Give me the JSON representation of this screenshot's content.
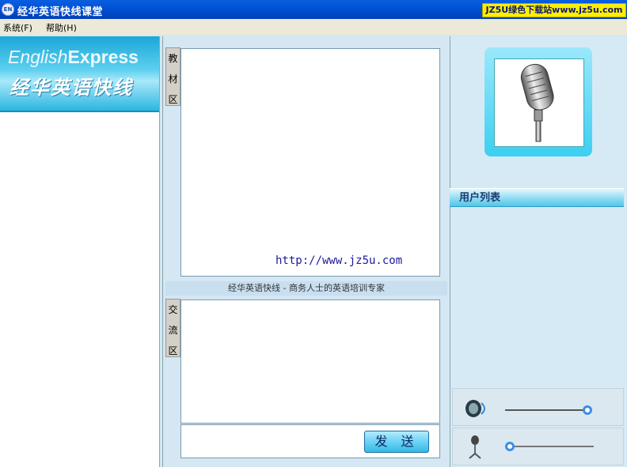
{
  "window": {
    "icon_text": "EN",
    "title": "经华英语快线课堂",
    "promo": "JZ5U绿色下载站www.jz5u.com"
  },
  "menu": [
    {
      "label": "系统(F)"
    },
    {
      "label": "帮助(H)"
    }
  ],
  "logo": {
    "english_light": "English",
    "english_bold": "Express",
    "chinese": "经华英语快线"
  },
  "textbook": {
    "tab_chars": [
      "教",
      "材",
      "区"
    ],
    "watermark": "http://www.jz5u.com"
  },
  "slogan": "经华英语快线 - 商务人士的英语培训专家",
  "chat": {
    "tab_chars": [
      "交",
      "流",
      "区"
    ],
    "input_value": "",
    "send_label": "发 送"
  },
  "users": {
    "header": "用户列表",
    "items": []
  },
  "speaker_volume_level": 1.0,
  "microphone_volume_level": 0.0
}
